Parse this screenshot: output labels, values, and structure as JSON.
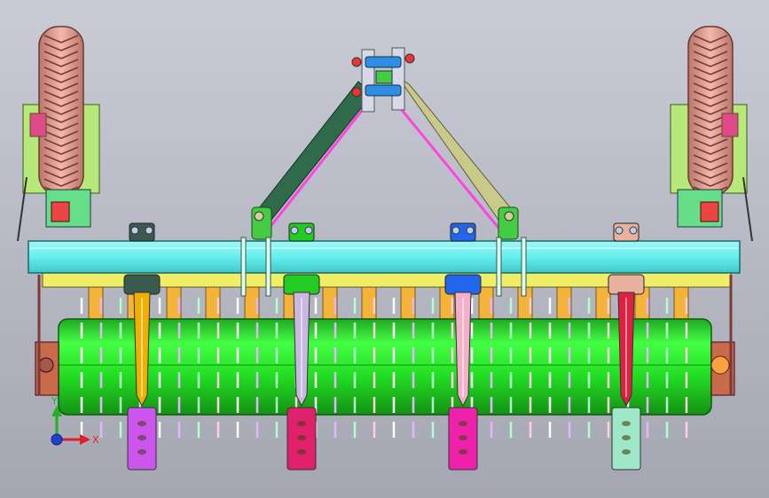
{
  "viewport": {
    "title": "",
    "background_top": "#c9ccd6",
    "background_bottom": "#a4a7b1"
  },
  "triad": {
    "x_label": "X",
    "y_label": "Y",
    "x_color": "#e02020",
    "y_color": "#20b020",
    "origin_color": "#2040d0"
  },
  "model": {
    "roller_color": "#22dd22",
    "frame_beam_color": "#66eeee",
    "under_beam_color": "#f0ee66",
    "hitch_left_color": "#2f6b4a",
    "hitch_right_color": "#c9c98a",
    "brace_color": "#ff44dd",
    "tire_color": "#e8a49a",
    "tine_colors": [
      "#f0b000",
      "#c9b8e0",
      "#f4b0c8",
      "#e02040"
    ],
    "foot_colors": [
      "#cc55ee",
      "#e0206a",
      "#ee22aa",
      "#9ee8c8"
    ],
    "bracket_colors": [
      "#3a5a50",
      "#22cc22",
      "#2266ee",
      "#eab0a0"
    ]
  }
}
